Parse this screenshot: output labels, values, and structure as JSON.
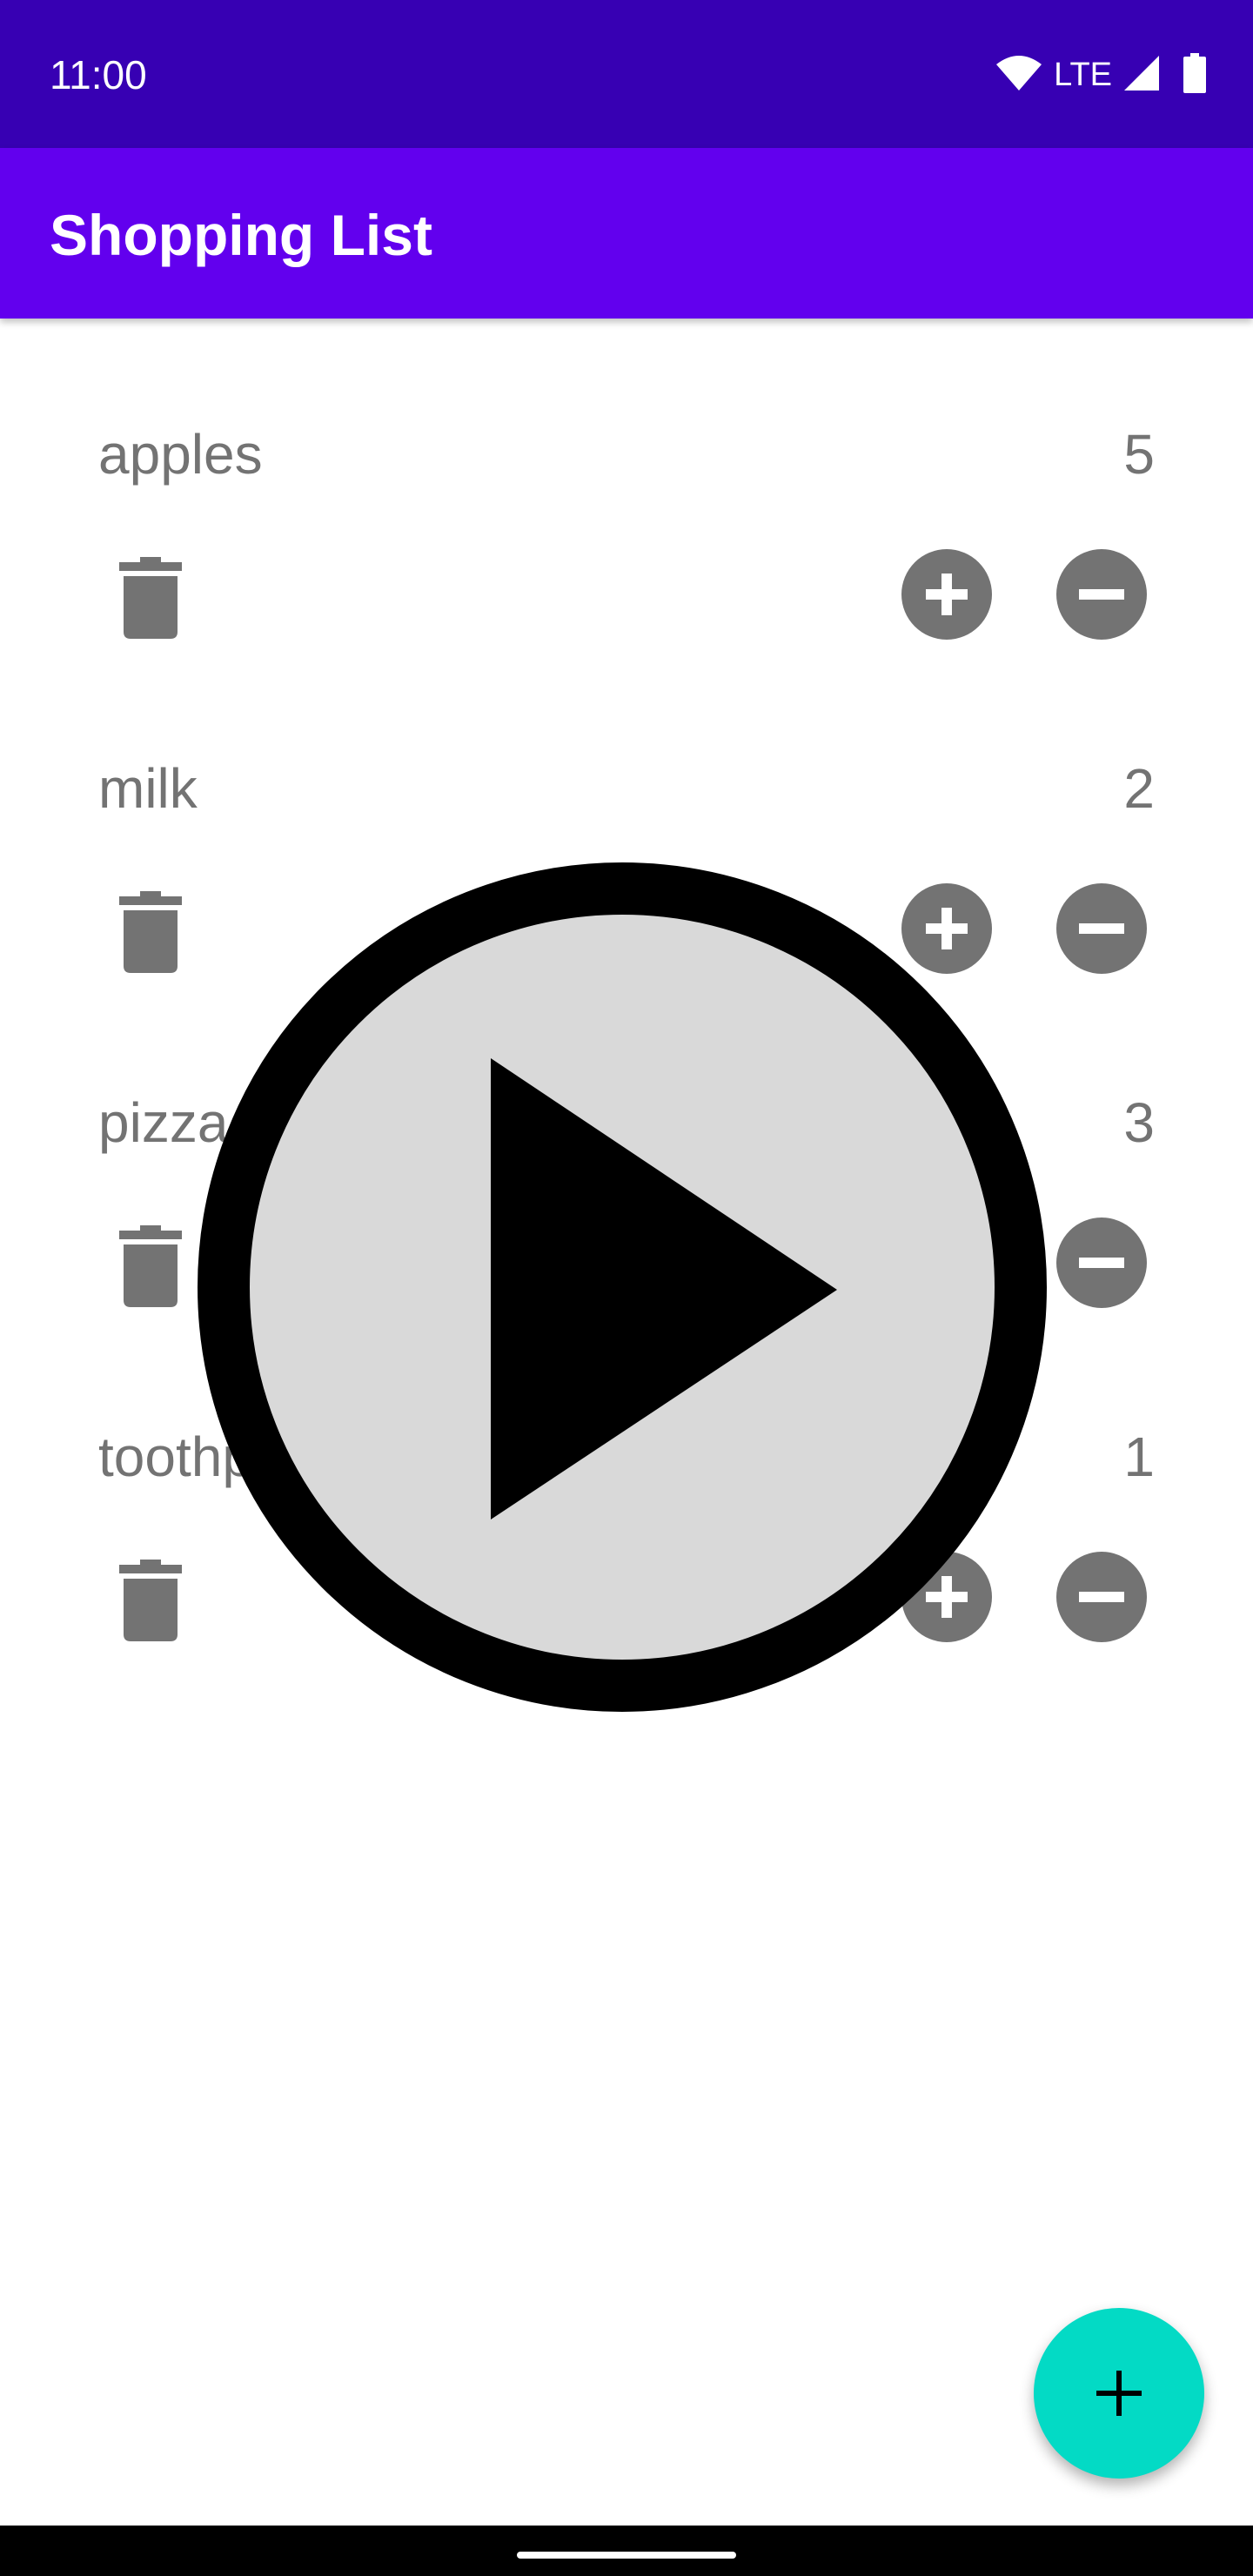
{
  "status_bar": {
    "time": "11:00",
    "network": "LTE",
    "icons": [
      "wifi-icon",
      "signal-icon",
      "battery-icon"
    ],
    "background": "#3700b3"
  },
  "app_bar": {
    "title": "Shopping List",
    "background": "#6200ee"
  },
  "items": [
    {
      "name": "apples",
      "quantity": "5"
    },
    {
      "name": "milk",
      "quantity": "2"
    },
    {
      "name": "pizza",
      "quantity": "3"
    },
    {
      "name": "toothpaste",
      "quantity": "1"
    }
  ],
  "item_icons": {
    "delete": "trash-icon",
    "increase": "plus-circle-icon",
    "decrease": "minus-circle-icon",
    "icon_color": "#737373"
  },
  "overlay": {
    "icon": "play-icon",
    "fill": "#d9d9d9",
    "stroke": "#000000"
  },
  "fab": {
    "icon": "plus-icon",
    "background": "#03dac5"
  }
}
